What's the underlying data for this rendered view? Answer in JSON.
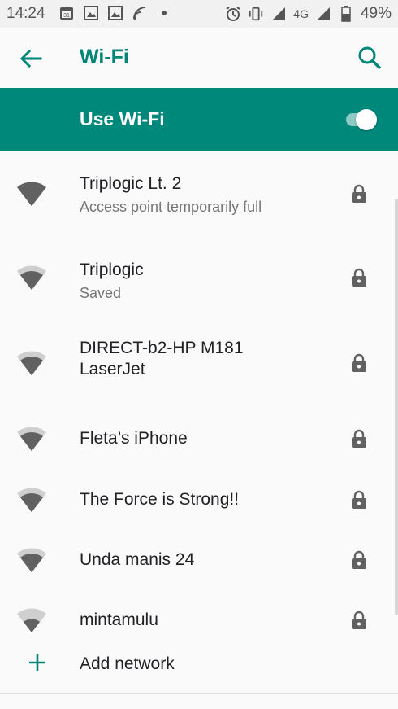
{
  "status_bar": {
    "time": "14:24",
    "network_label": "4G",
    "battery": "49%",
    "icons": [
      "calendar-icon",
      "photo-icon",
      "photo-icon",
      "cast-icon",
      "dot-icon",
      "alarm-icon",
      "vibrate-icon",
      "signal-icon",
      "signal-icon",
      "battery-icon"
    ]
  },
  "app_bar": {
    "title": "Wi-Fi",
    "back_icon": "back-arrow-icon",
    "search_icon": "search-icon"
  },
  "use_wifi": {
    "label": "Use Wi-Fi",
    "enabled": true
  },
  "networks": [
    {
      "name": "Triplogic Lt. 2",
      "status": "Access point temporarily full",
      "signal": 4,
      "secured": true
    },
    {
      "name": "Triplogic",
      "status": "Saved",
      "signal": 3,
      "secured": true
    },
    {
      "name": "DIRECT-b2-HP M181 LaserJet",
      "status": "",
      "signal": 3,
      "secured": true
    },
    {
      "name": "Fleta’s iPhone",
      "status": "",
      "signal": 3,
      "secured": true
    },
    {
      "name": "The Force is Strong!!",
      "status": "",
      "signal": 3,
      "secured": true
    },
    {
      "name": "Unda manis 24",
      "status": "",
      "signal": 3,
      "secured": true
    },
    {
      "name": "mintamulu",
      "status": "",
      "signal": 2,
      "secured": true
    }
  ],
  "add_network": {
    "label": "Add network"
  },
  "colors": {
    "accent": "#008577",
    "toolbar_green": "#00897b",
    "icon_gray": "#616161",
    "icon_light": "#cfcfcf"
  }
}
